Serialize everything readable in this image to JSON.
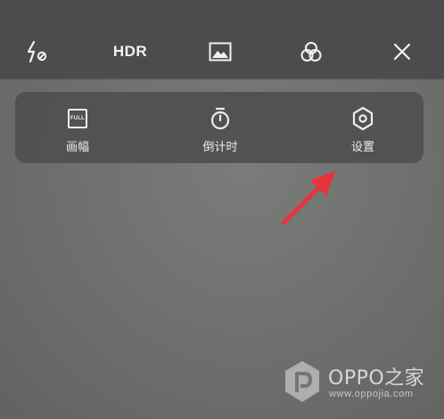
{
  "top_bar": {
    "flash_icon": "flash-off-icon",
    "hdr_label": "HDR",
    "gallery_icon": "image-icon",
    "filter_icon": "filter-circles-icon",
    "close_icon": "close-icon"
  },
  "panel": {
    "items": [
      {
        "icon": "full-frame-icon",
        "icon_text": "FULL",
        "label": "画幅"
      },
      {
        "icon": "timer-icon",
        "label": "倒计时"
      },
      {
        "icon": "settings-hexagon-icon",
        "label": "设置"
      }
    ]
  },
  "annotation": {
    "arrow_color": "#e8333a"
  },
  "watermark": {
    "brand": "OPPO之家",
    "url": "www.oppojia.com"
  },
  "colors": {
    "top_bar_bg": "#4b4c4b",
    "panel_bg": "#4e504e",
    "icon": "#f2f2f2"
  }
}
